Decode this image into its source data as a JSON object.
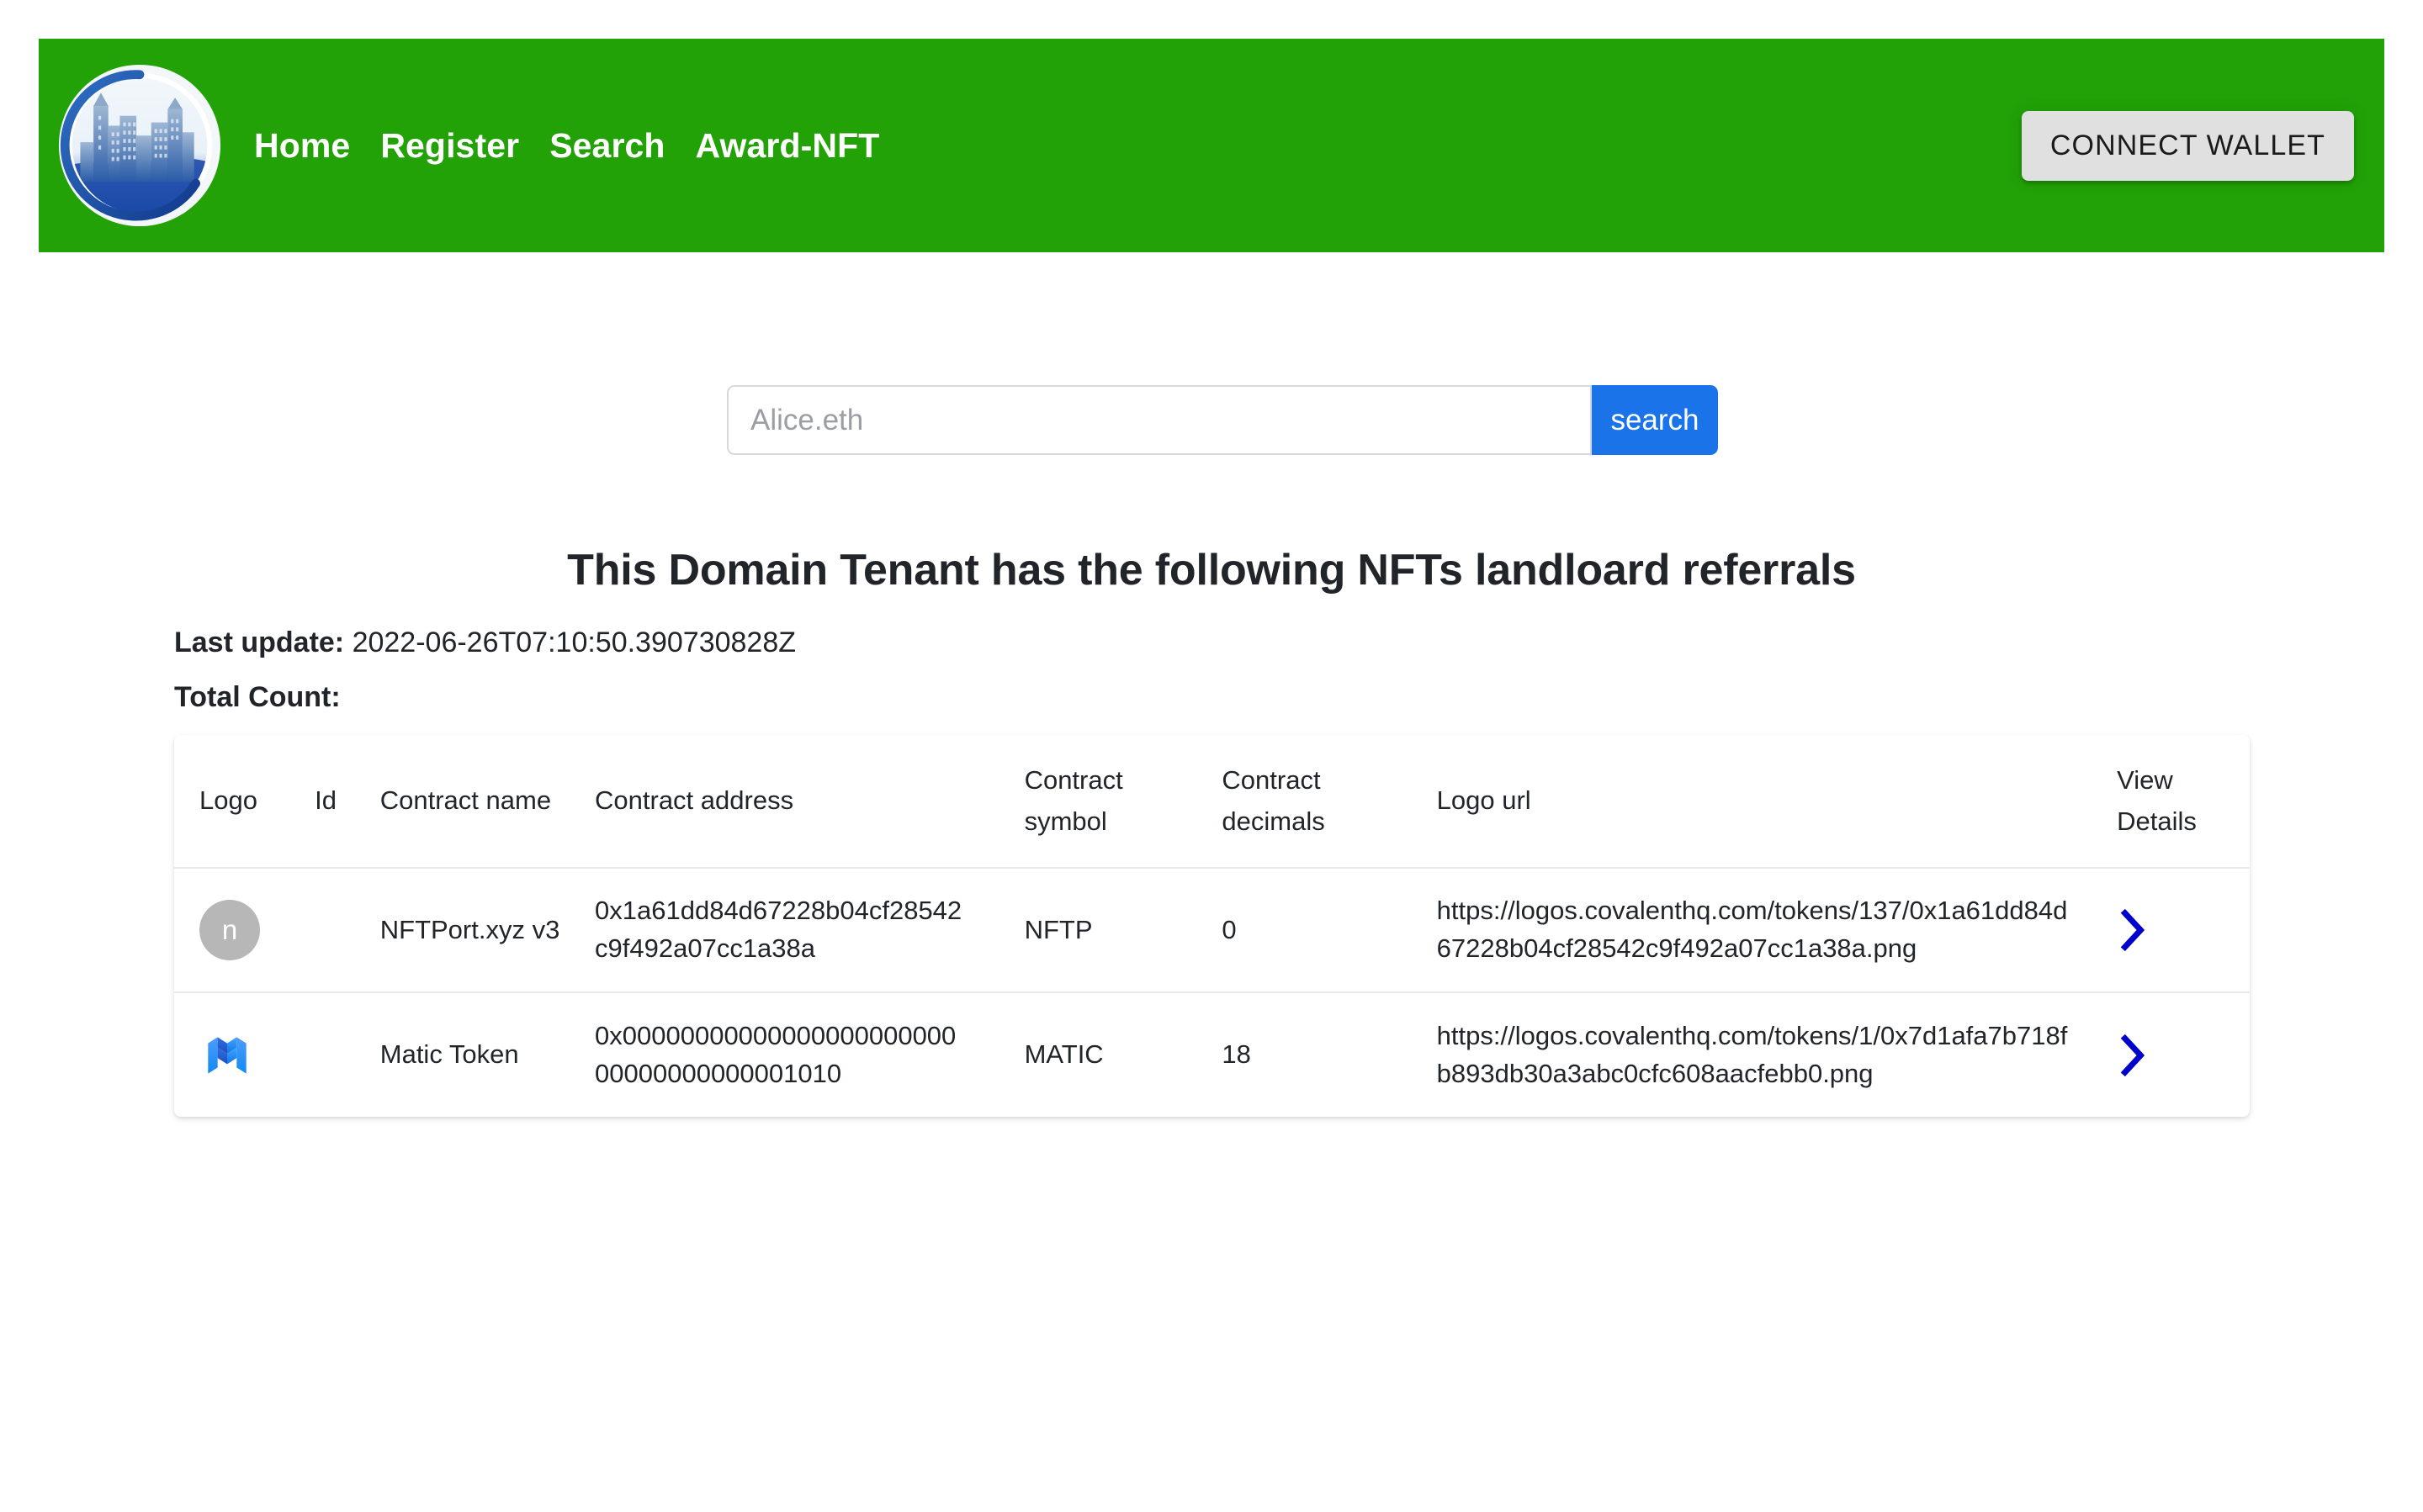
{
  "navbar": {
    "logo_alt": "city-skyline-logo",
    "links": [
      {
        "label": "Home"
      },
      {
        "label": "Register"
      },
      {
        "label": "Search"
      },
      {
        "label": "Award-NFT"
      }
    ],
    "connect_wallet_label": "CONNECT WALLET",
    "background_color": "#22a206"
  },
  "search": {
    "placeholder": "Alice.eth",
    "value": "",
    "button_label": "search",
    "button_color": "#1a73e8"
  },
  "main": {
    "heading": "This Domain Tenant has the following NFTs landloard referrals",
    "last_update_label": "Last update:",
    "last_update_value": "2022-06-26T07:10:50.390730828Z",
    "total_count_label": "Total Count:",
    "total_count_value": ""
  },
  "table": {
    "headers": [
      "Logo",
      "Id",
      "Contract name",
      "Contract address",
      "Contract symbol",
      "Contract decimals",
      "Logo url",
      "View Details"
    ],
    "rows": [
      {
        "logo_type": "initial-avatar",
        "logo_initial": "n",
        "id": "",
        "contract_name": "NFTPort.xyz v3",
        "contract_address": "0x1a61dd84d67228b04cf28542c9f492a07cc1a38a",
        "contract_symbol": "NFTP",
        "contract_decimals": "0",
        "logo_url": "https://logos.covalenthq.com/tokens/137/0x1a61dd84d67228b04cf28542c9f492a07cc1a38a.png",
        "view_details_icon": "chevron-right-icon"
      },
      {
        "logo_type": "matic-logo",
        "logo_initial": "",
        "id": "",
        "contract_name": "Matic Token",
        "contract_address": "0x0000000000000000000000000000000000001010",
        "contract_symbol": "MATIC",
        "contract_decimals": "18",
        "logo_url": "https://logos.covalenthq.com/tokens/1/0x7d1afa7b718fb893db30a3abc0cfc608aacfebb0.png",
        "view_details_icon": "chevron-right-icon"
      }
    ],
    "chevron_color": "#0000cc"
  }
}
